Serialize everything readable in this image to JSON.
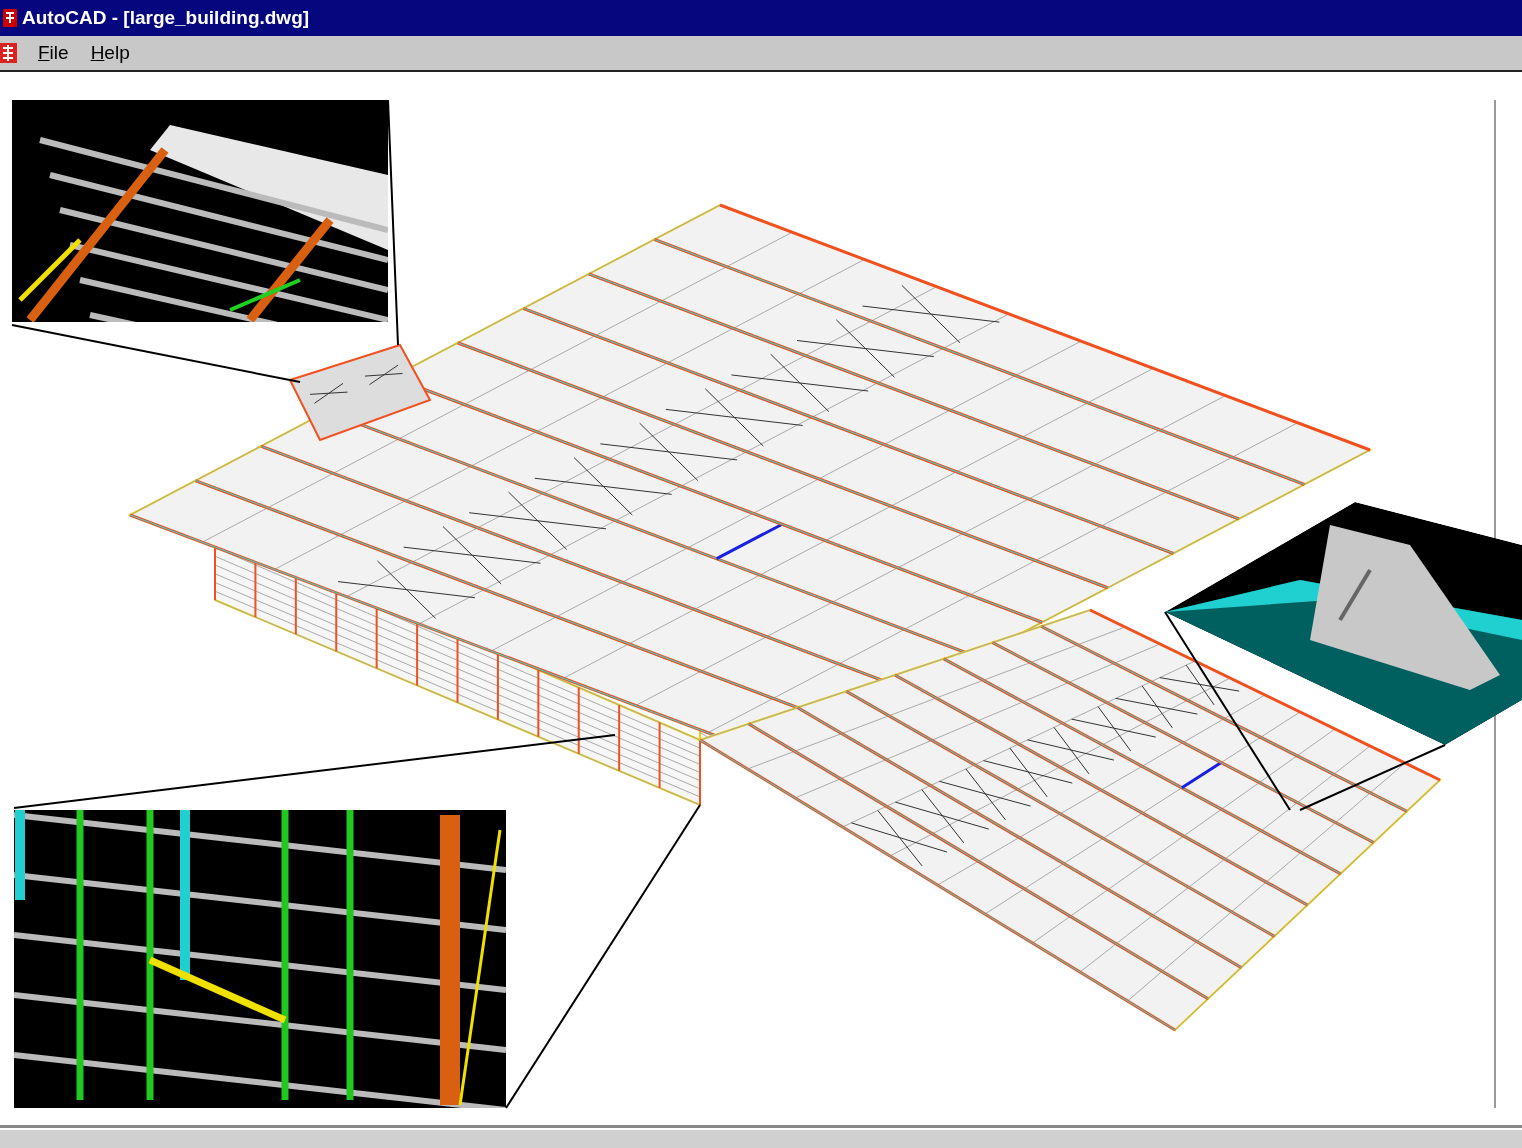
{
  "window": {
    "title": "AutoCAD - [large_building.dwg]"
  },
  "menu": [
    {
      "label": "File"
    },
    {
      "label": "Help"
    }
  ]
}
